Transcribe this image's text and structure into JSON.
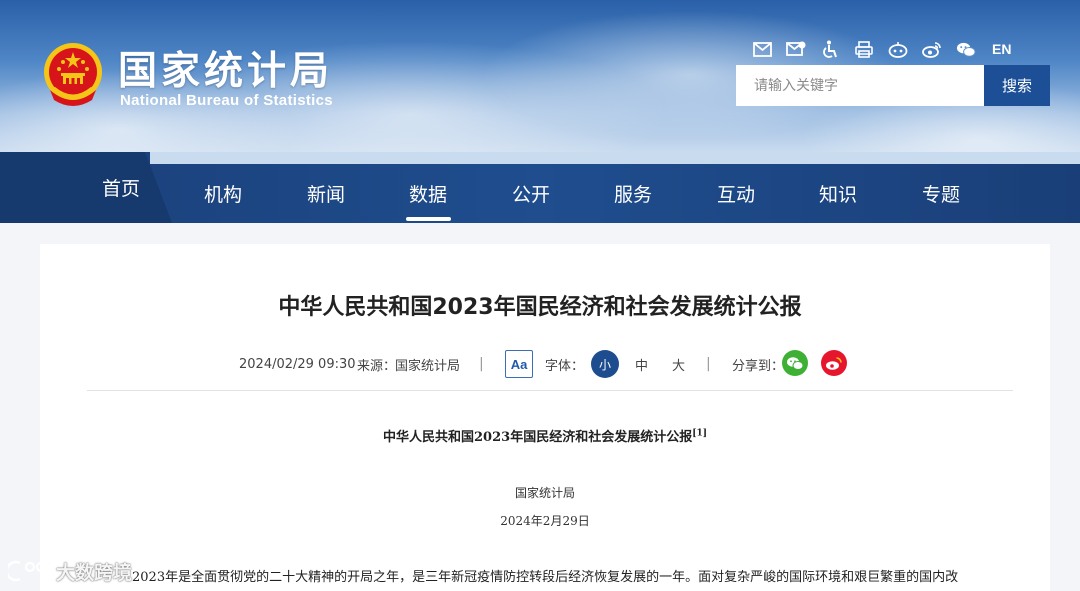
{
  "site": {
    "name_cn": "国家统计局",
    "name_en": "National Bureau of Statistics"
  },
  "toolbar": {
    "icons": [
      "mail-icon",
      "mail-edit-icon",
      "accessibility-icon",
      "print-icon",
      "robot-icon",
      "weibo-icon",
      "wechat-icon"
    ],
    "lang_label": "EN"
  },
  "search": {
    "placeholder": "请输入关键字",
    "button_label": "搜索"
  },
  "nav": {
    "items": [
      "首页",
      "机构",
      "新闻",
      "数据",
      "公开",
      "服务",
      "互动",
      "知识",
      "专题"
    ],
    "active": "数据"
  },
  "article": {
    "title": "中华人民共和国2023年国民经济和社会发展统计公报",
    "datetime": "2024/02/29 09:30",
    "source_label": "来源：",
    "source": "国家统计局",
    "aa_label": "Aa",
    "font_label": "字体：",
    "font_sizes": [
      "小",
      "中",
      "大"
    ],
    "font_selected": "小",
    "share_label": "分享到：",
    "share_icons": [
      "wechat-share-icon",
      "weibo-share-icon"
    ]
  },
  "document": {
    "title": "中华人民共和国2023年国民经济和社会发展统计公报",
    "footnote_ref": "[1]",
    "org": "国家统计局",
    "date": "2024年2月29日",
    "first_paragraph": "2023年是全面贯彻党的二十大精神的开局之年，是三年新冠疫情防控转段后经济恢复发展的一年。面对复杂严峻的国际环境和艰巨繁重的国内改"
  },
  "watermark": {
    "text": "大数跨境"
  },
  "colors": {
    "nav_bg": "#1f4d8e",
    "search_button": "#1c4f95",
    "wechat_green": "#3eb135",
    "weibo_red": "#e6162d",
    "emblem_red": "#d7141a",
    "emblem_gold": "#f5c518"
  }
}
